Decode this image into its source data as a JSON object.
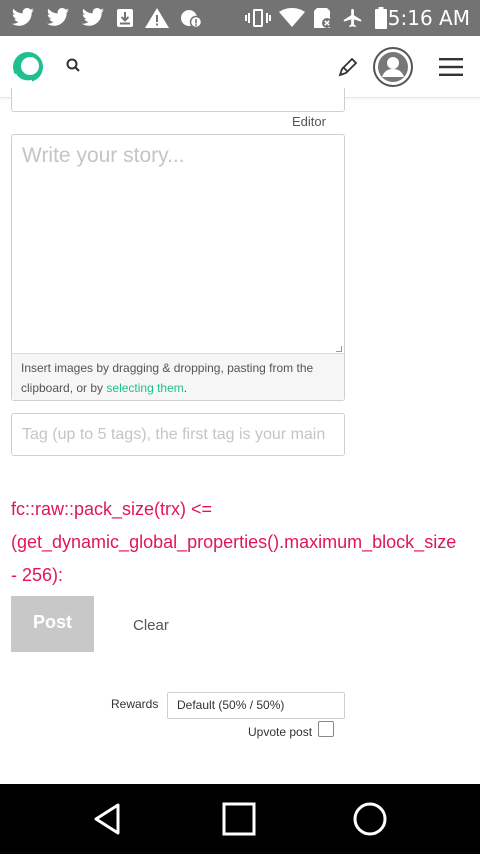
{
  "status_bar": {
    "time": "5:16 AM",
    "icons": [
      "twitter-icon",
      "twitter-icon",
      "twitter-icon",
      "download-icon",
      "warning-icon",
      "sync-icon",
      "vibrate-icon",
      "wifi-icon",
      "sd-card-icon",
      "airplane-icon",
      "battery-icon"
    ]
  },
  "header": {
    "logo": "steemit-logo",
    "search_icon": "search-icon",
    "write_icon": "pen-icon",
    "avatar_icon": "avatar-icon",
    "menu_icon": "hamburger-menu-icon"
  },
  "editor": {
    "mode_label": "Editor",
    "body_placeholder": "Write your story...",
    "upload_hint_prefix": "Insert images by dragging & dropping, pasting from the clipboard, or by ",
    "upload_hint_link": "selecting them",
    "upload_hint_suffix": ".",
    "tags_placeholder": "Tag (up to 5 tags), the first tag is your main"
  },
  "error": {
    "line1": "fc::raw::pack_size(trx) <=",
    "line2": "(get_dynamic_global_properties().maximum_block_size",
    "line3": "- 256):"
  },
  "actions": {
    "post_label": "Post",
    "clear_label": "Clear"
  },
  "options": {
    "rewards_label": "Rewards",
    "rewards_value": "Default (50% / 50%)",
    "upvote_label": "Upvote post",
    "upvote_checked": false
  },
  "nav": {
    "back": "back-icon",
    "home": "home-icon",
    "recents": "recents-icon"
  },
  "colors": {
    "status_bar": "#737373",
    "brand": "#1fbf8f",
    "error": "#e0155d",
    "post_button": "#c8c8c8"
  }
}
